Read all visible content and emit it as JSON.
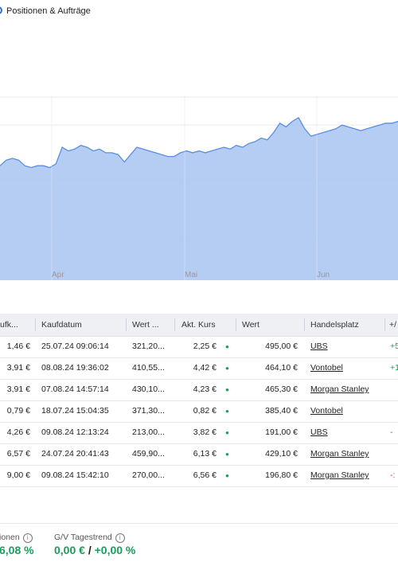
{
  "header": {
    "title": "Positionen & Aufträge"
  },
  "chart_data": {
    "type": "area",
    "x_ticks": [
      "Apr",
      "Mai",
      "Jun"
    ],
    "values": [
      62,
      65,
      66,
      65,
      62,
      61,
      62,
      62,
      61,
      63,
      72,
      70,
      71,
      73,
      72,
      70,
      71,
      69,
      69,
      68,
      64,
      68,
      72,
      71,
      70,
      69,
      68,
      67,
      67,
      69,
      70,
      69,
      70,
      69,
      70,
      71,
      72,
      71,
      73,
      72,
      74,
      75,
      77,
      76,
      80,
      85,
      83,
      86,
      88,
      82,
      78,
      79,
      80,
      81,
      82,
      84,
      83,
      82,
      81,
      82,
      83,
      84,
      85,
      85,
      86
    ],
    "ylim": [
      0,
      100
    ],
    "grid": true,
    "colors": {
      "line": "#5b8ee0",
      "fill": "#a9c4f1"
    }
  },
  "table": {
    "columns": [
      "ufk...",
      "Kaufdatum",
      "Wert ...",
      "Akt. Kurs",
      "Wert",
      "Handelsplatz",
      "+/"
    ],
    "rows": [
      {
        "kauf": "1,46 €",
        "datum": "25.07.24 09:06:14",
        "wert1": "321,20...",
        "kurs": "2,25 €",
        "wert": "495,00 €",
        "platz": "UBS",
        "trend": "+5",
        "trend_sign": "pos"
      },
      {
        "kauf": "3,91 €",
        "datum": "08.08.24 19:36:02",
        "wert1": "410,55...",
        "kurs": "4,42 €",
        "wert": "464,10 €",
        "platz": "Vontobel",
        "trend": "+1",
        "trend_sign": "pos"
      },
      {
        "kauf": "3,91 €",
        "datum": "07.08.24 14:57:14",
        "wert1": "430,10...",
        "kurs": "4,23 €",
        "wert": "465,30 €",
        "platz": "Morgan Stanley",
        "trend": "",
        "trend_sign": "pos"
      },
      {
        "kauf": "0,79 €",
        "datum": "18.07.24 15:04:35",
        "wert1": "371,30...",
        "kurs": "0,82 €",
        "wert": "385,40 €",
        "platz": "Vontobel",
        "trend": "",
        "trend_sign": "pos"
      },
      {
        "kauf": "4,26 €",
        "datum": "09.08.24 12:13:24",
        "wert1": "213,00...",
        "kurs": "3,82 €",
        "wert": "191,00 €",
        "platz": "UBS",
        "trend": "-",
        "trend_sign": "neg"
      },
      {
        "kauf": "6,57 €",
        "datum": "24.07.24 20:41:43",
        "wert1": "459,90...",
        "kurs": "6,13 €",
        "wert": "429,10 €",
        "platz": "Morgan Stanley",
        "trend": "",
        "trend_sign": "neg"
      },
      {
        "kauf": "9,00 €",
        "datum": "09.08.24 15:42:10",
        "wert1": "270,00...",
        "kurs": "6,56 €",
        "wert": "196,80 €",
        "platz": "Morgan Stanley",
        "trend": "-:",
        "trend_sign": "neg"
      }
    ]
  },
  "footer": {
    "label1": "ionen",
    "value1": "6,08 %",
    "label2": "G/V Tagestrend",
    "value2a": "0,00 €",
    "value2sep": "/",
    "value2b": "+0,00 %"
  }
}
